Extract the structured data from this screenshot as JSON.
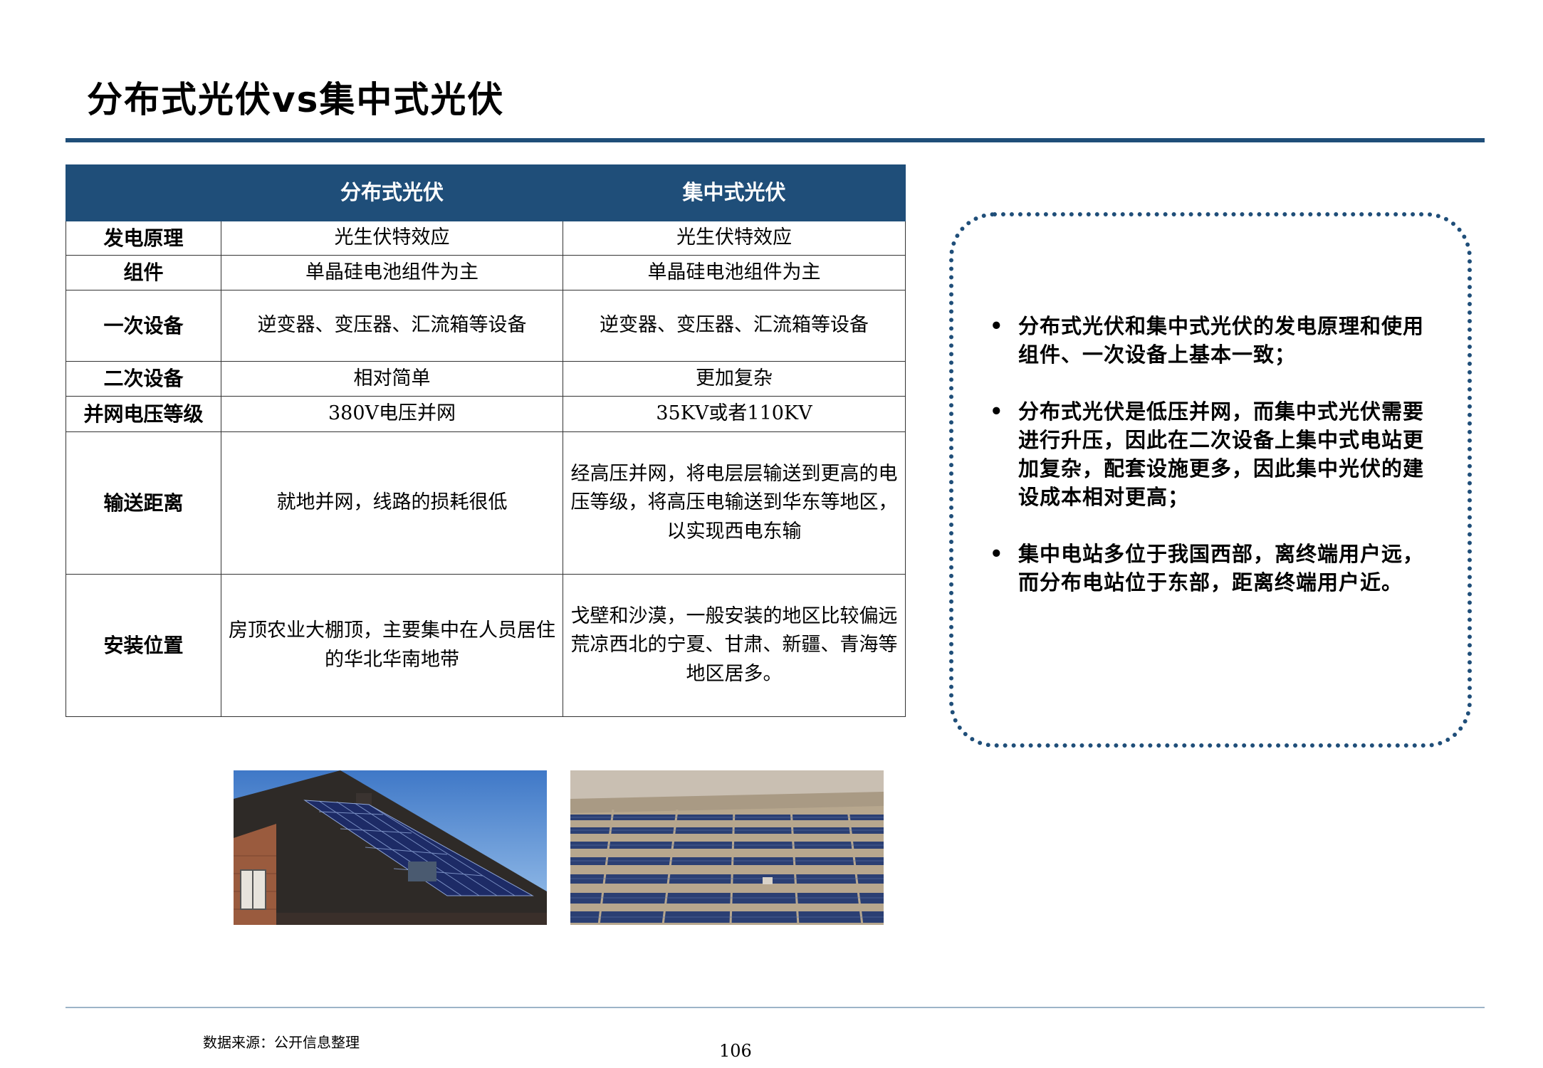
{
  "title": "分布式光伏vs集中式光伏",
  "table": {
    "headers": [
      "",
      "分布式光伏",
      "集中式光伏"
    ],
    "rows": [
      {
        "label": "发电原理",
        "distributed": "光生伏特效应",
        "centralized": "光生伏特效应"
      },
      {
        "label": "组件",
        "distributed": "单晶硅电池组件为主",
        "centralized": "单晶硅电池组件为主"
      },
      {
        "label": "一次设备",
        "distributed": "逆变器、变压器、汇流箱等设备",
        "centralized": "逆变器、变压器、汇流箱等设备"
      },
      {
        "label": "二次设备",
        "distributed": "相对简单",
        "centralized": "更加复杂"
      },
      {
        "label": "并网电压等级",
        "distributed": "380V电压并网",
        "centralized": "35KV或者110KV"
      },
      {
        "label": "输送距离",
        "distributed": "就地并网，线路的损耗很低",
        "centralized": "经高压并网，将电层层输送到更高的电压等级，将高压电输送到华东等地区，以实现西电东输"
      },
      {
        "label": "安装位置",
        "distributed": "房顶农业大棚顶，主要集中在人员居住的华北华南地带",
        "centralized": "戈壁和沙漠，一般安装的地区比较偏远荒凉西北的宁夏、甘肃、新疆、青海等地区居多。"
      }
    ]
  },
  "notes": [
    "分布式光伏和集中式光伏的发电原理和使用组件、一次设备上基本一致；",
    "分布式光伏是低压并网，而集中式光伏需要进行升压，因此在二次设备上集中式电站更加复杂，配套设施更多，因此集中光伏的建设成本相对更高；",
    "集中电站多位于我国西部，离终端用户远，而分布电站位于东部，距离终端用户近。"
  ],
  "bullet_glyph": "•",
  "source": "数据来源：公开信息整理",
  "page_number": "106",
  "colors": {
    "accent": "#1F4E79",
    "header_text": "#ffffff"
  }
}
